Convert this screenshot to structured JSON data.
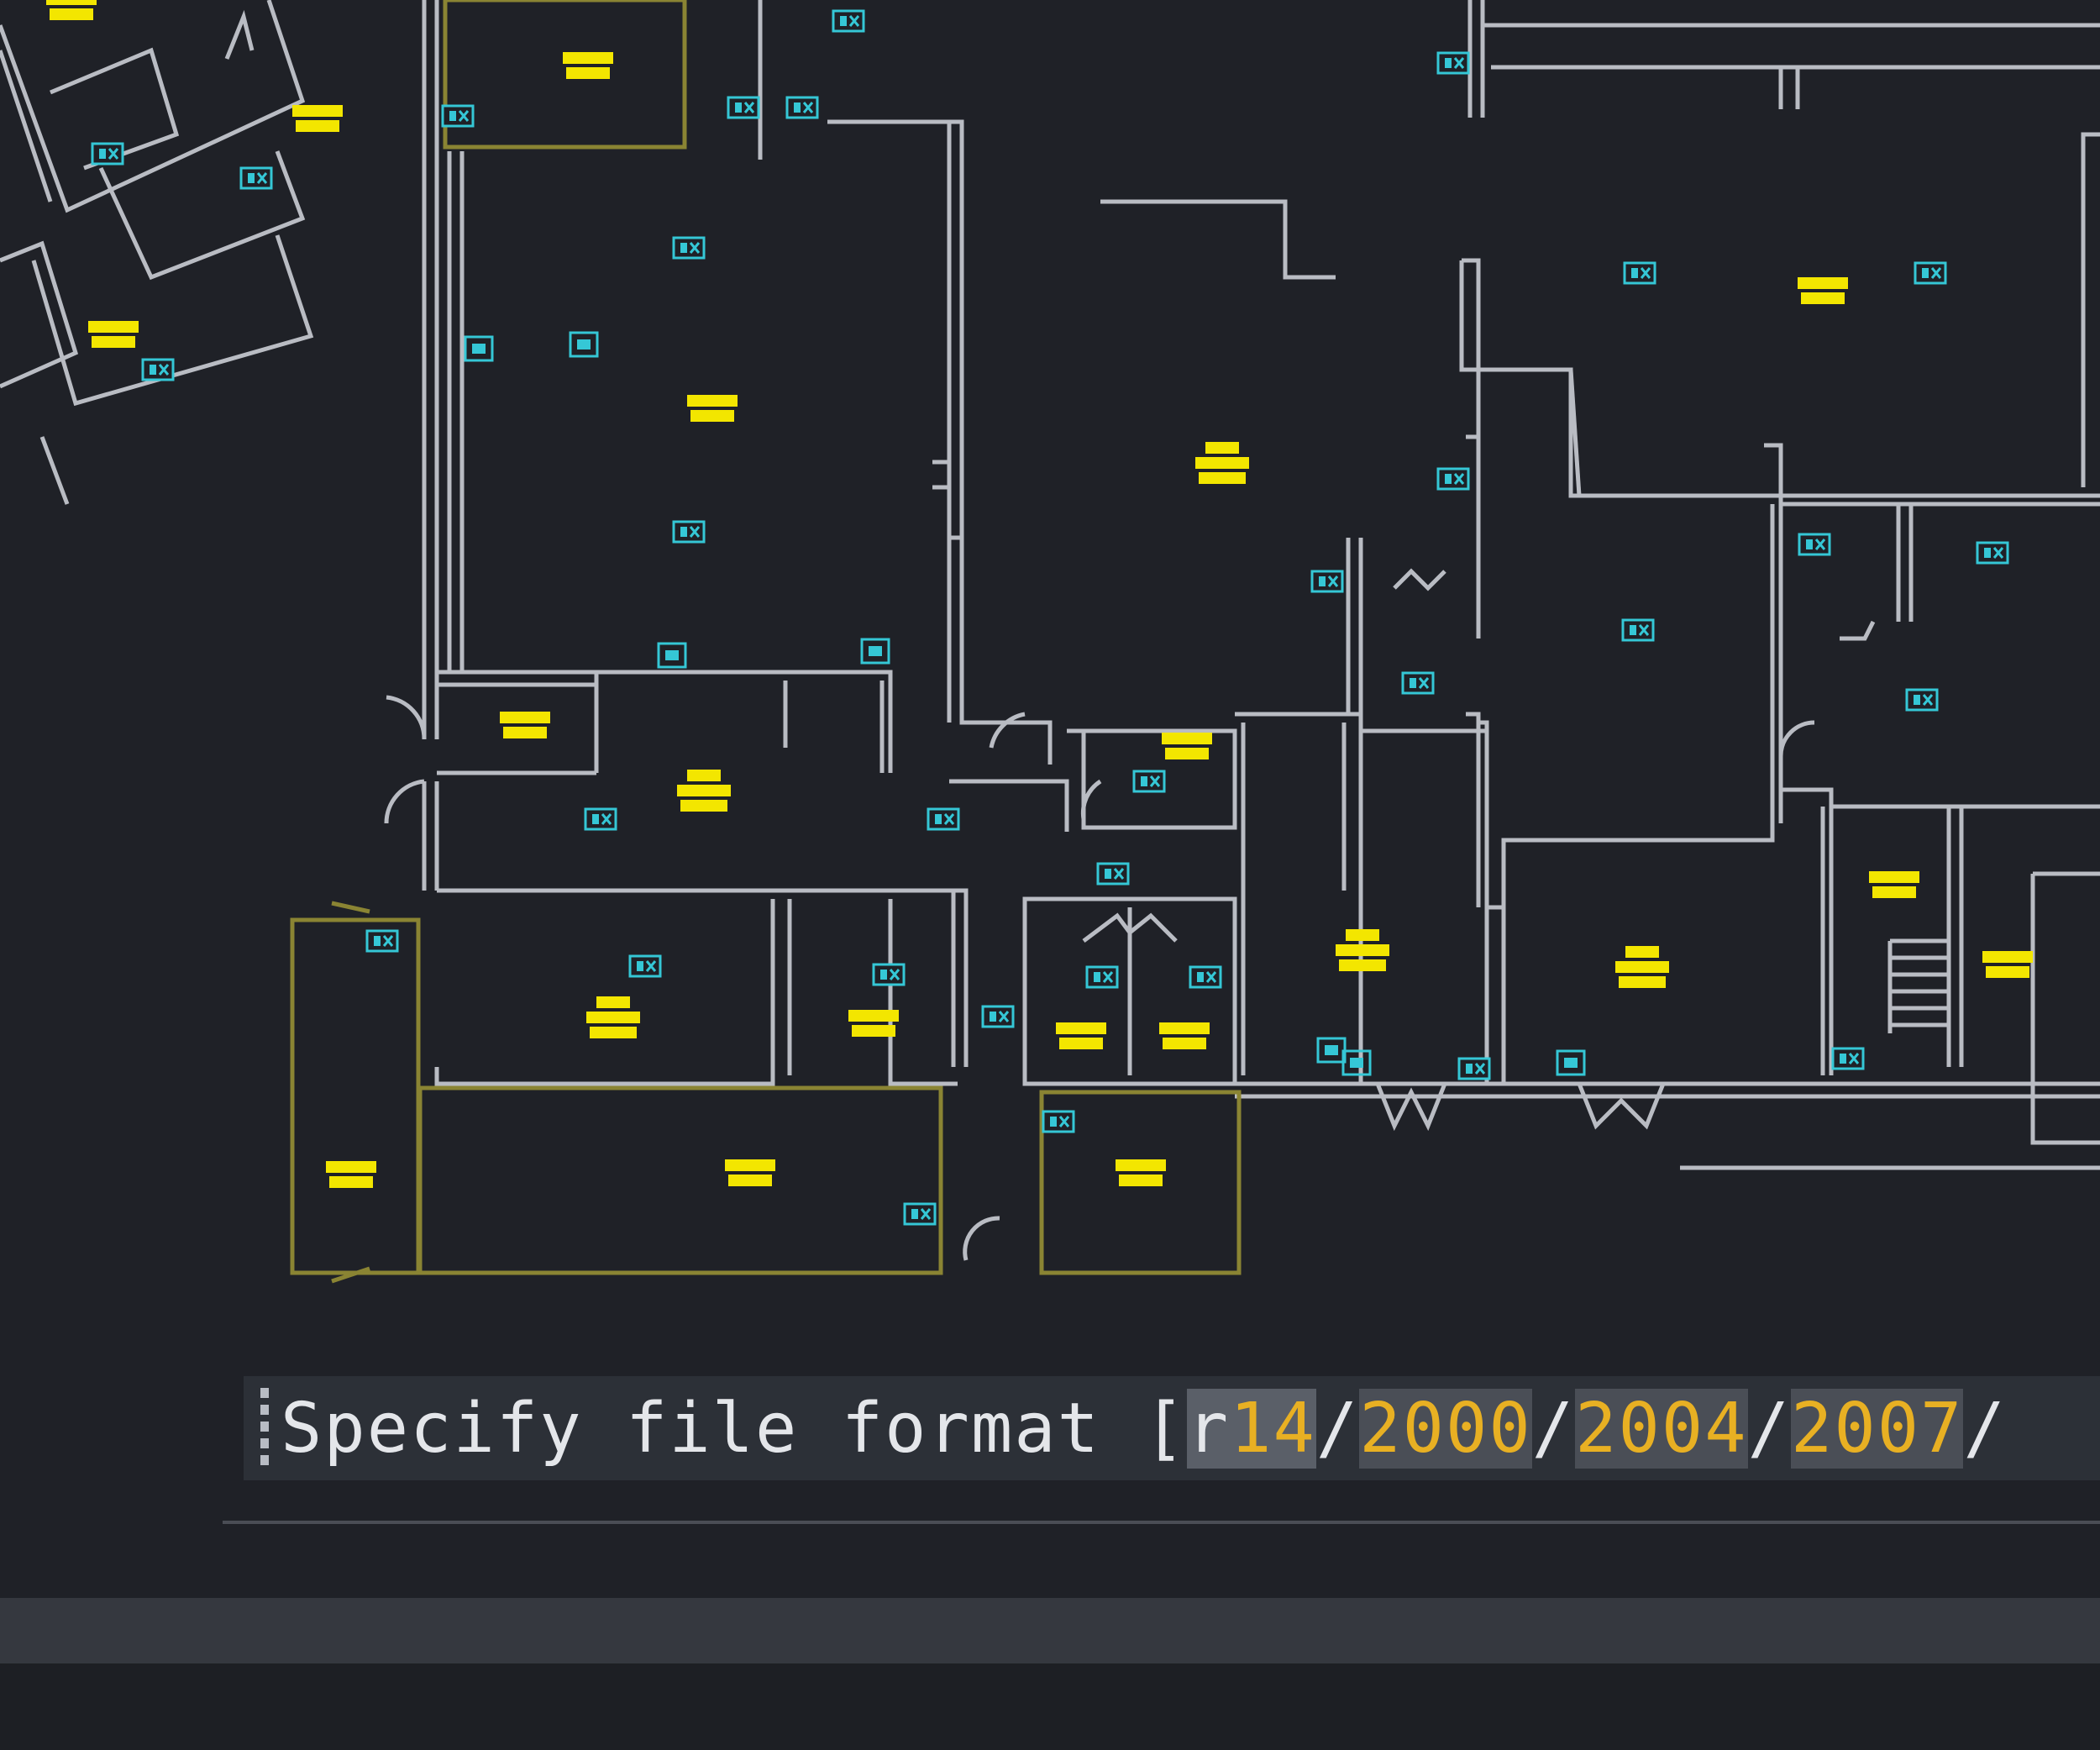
{
  "command_line": {
    "prompt": "Specify file format [",
    "options": [
      {
        "first": "r",
        "rest": "14"
      },
      {
        "first": "",
        "rest": "2000"
      },
      {
        "first": "",
        "rest": "2004"
      },
      {
        "first": "",
        "rest": "2007"
      }
    ],
    "separator": "/",
    "trailing": "/"
  },
  "colors": {
    "background": "#1f2127",
    "walls": "#b9bcc3",
    "highlight_rooms": "#8a8433",
    "lights": "#f3e600",
    "sensors": "#35c7d6",
    "option_keyword": "#e8b023"
  },
  "icons": [
    "light-fixture-icon",
    "occupancy-sensor-icon",
    "wall-switch-icon"
  ]
}
